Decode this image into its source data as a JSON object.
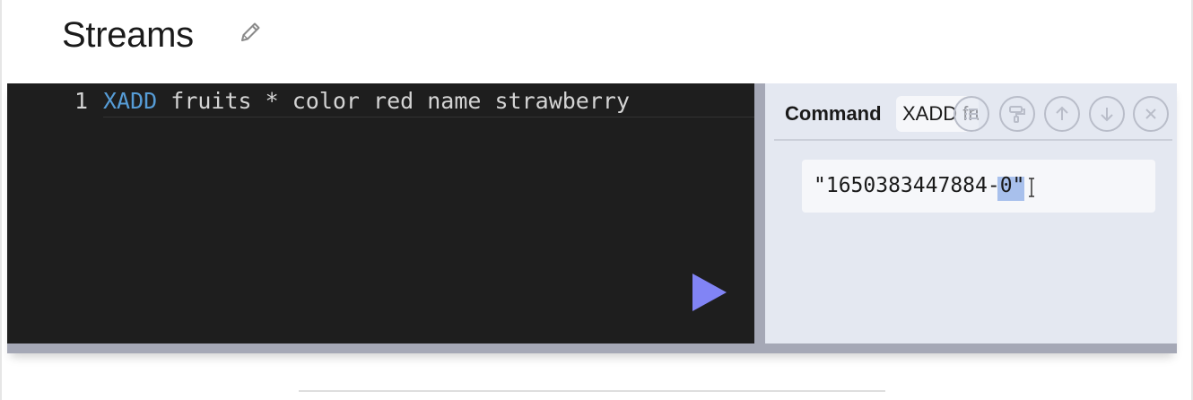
{
  "page": {
    "title": "Streams"
  },
  "editor": {
    "line_number": "1",
    "keyword": "XADD",
    "rest_of_line": " fruits * color red name strawberry"
  },
  "result": {
    "command_label": "Command",
    "command_value": "XADD fruits * color red name strawberry",
    "output": "\"1650383447884-0\""
  },
  "icons": {
    "edit": "pencil-icon",
    "run": "play-icon",
    "format": "list-icon",
    "paint": "paint-roller-icon",
    "up": "arrow-up-icon",
    "down": "arrow-down-icon",
    "close": "close-icon"
  },
  "colors": {
    "editor_bg": "#1e1e1e",
    "keyword": "#569cd6",
    "run_button": "#8184f5",
    "result_bg": "#e4e8f1",
    "selection": "#a8c0ec"
  }
}
